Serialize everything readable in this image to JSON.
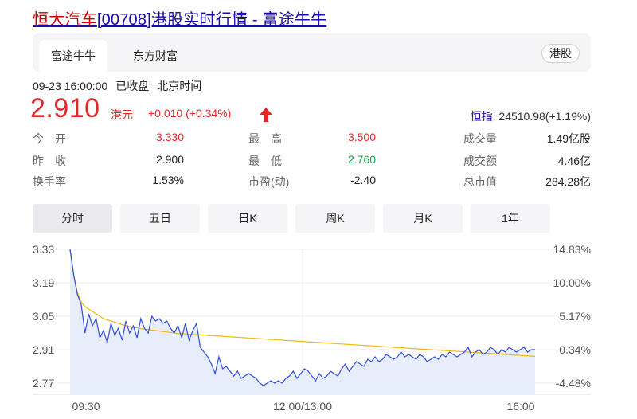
{
  "title": {
    "brand": "恒大汽车",
    "rest": "[00708]港股实时行情 - 富途牛牛"
  },
  "tabs": [
    {
      "label": "富途牛牛",
      "active": true
    },
    {
      "label": "东方财富",
      "active": false
    }
  ],
  "market_pill": "港股",
  "status": {
    "datetime": "09-23 16:00:00",
    "state": "已收盘",
    "timezone": "北京时间"
  },
  "quote": {
    "price": "2.910",
    "currency": "港元",
    "change": "+0.010 (+0.34%)",
    "direction": "up"
  },
  "index": {
    "label": "恒指",
    "value": ": 24510.98(+1.19%)"
  },
  "stats": [
    [
      {
        "label": "今　开",
        "value": "3.330",
        "color": "red"
      },
      {
        "label": "最　高",
        "value": "3.500",
        "color": "red"
      },
      {
        "label": "成交量",
        "value": "1.49亿股",
        "color": "normal"
      }
    ],
    [
      {
        "label": "昨　收",
        "value": "2.900",
        "color": "normal"
      },
      {
        "label": "最　低",
        "value": "2.760",
        "color": "green"
      },
      {
        "label": "成交额",
        "value": "4.46亿",
        "color": "normal"
      }
    ],
    [
      {
        "label": "换手率",
        "value": "1.53%",
        "color": "normal"
      },
      {
        "label": "市盈(动)",
        "value": "-2.40",
        "color": "normal"
      },
      {
        "label": "总市值",
        "value": "284.28亿",
        "color": "normal"
      }
    ]
  ],
  "periods": [
    {
      "label": "分时",
      "active": true
    },
    {
      "label": "五日",
      "active": false
    },
    {
      "label": "日K",
      "active": false
    },
    {
      "label": "周K",
      "active": false
    },
    {
      "label": "月K",
      "active": false
    },
    {
      "label": "1年",
      "active": false
    }
  ],
  "colors": {
    "up": "#e0282a",
    "down": "#1aa350",
    "price_line": "#2f4fd9",
    "avg_line": "#f0b90b",
    "area_fill": "#e8edfb"
  },
  "chart_data": {
    "type": "line",
    "x_ticks": [
      "09:30",
      "12:00/13:00",
      "16:00"
    ],
    "y_ticks_left": [
      "3.33",
      "3.19",
      "3.05",
      "2.91",
      "2.77"
    ],
    "y_ticks_right": [
      "14.83%",
      "10.00%",
      "5.17%",
      "0.34%",
      "-4.48%"
    ],
    "ylim": [
      2.77,
      3.33
    ],
    "series": [
      {
        "role": "price",
        "values": [
          3.33,
          3.22,
          3.14,
          3.1,
          2.98,
          3.06,
          3.01,
          3.04,
          2.96,
          2.99,
          2.94,
          3.02,
          2.97,
          3.0,
          2.95,
          3.03,
          2.98,
          3.01,
          2.96,
          3.04,
          3.0,
          2.98,
          3.05,
          3.03,
          3.04,
          3.02,
          3.03,
          3.0,
          2.98,
          3.01,
          2.96,
          3.02,
          2.95,
          2.99,
          3.02,
          2.92,
          2.9,
          2.88,
          2.85,
          2.81,
          2.88,
          2.83,
          2.84,
          2.82,
          2.8,
          2.82,
          2.79,
          2.8,
          2.81,
          2.8,
          2.79,
          2.77,
          2.76,
          2.77,
          2.78,
          2.77,
          2.78,
          2.77,
          2.79,
          2.8,
          2.82,
          2.79,
          2.81,
          2.83,
          2.82,
          2.8,
          2.78,
          2.81,
          2.79,
          2.8,
          2.82,
          2.81,
          2.8,
          2.83,
          2.85,
          2.82,
          2.84,
          2.86,
          2.85,
          2.84,
          2.87,
          2.86,
          2.88,
          2.86,
          2.87,
          2.89,
          2.88,
          2.87,
          2.88,
          2.9,
          2.88,
          2.89,
          2.88,
          2.87,
          2.89,
          2.88,
          2.86,
          2.87,
          2.88,
          2.87,
          2.89,
          2.88,
          2.9,
          2.89,
          2.88,
          2.89,
          2.9,
          2.92,
          2.88,
          2.9,
          2.91,
          2.89,
          2.9,
          2.92,
          2.91,
          2.89,
          2.91,
          2.9,
          2.92,
          2.91,
          2.9,
          2.91,
          2.92,
          2.9,
          2.91,
          2.91
        ]
      },
      {
        "role": "average",
        "values": [
          3.33,
          3.22,
          3.15,
          3.11,
          3.09,
          3.08,
          3.07,
          3.06,
          3.05,
          3.04,
          3.035,
          3.03,
          3.025,
          3.02,
          3.015,
          3.01,
          3.007,
          3.004,
          3.001,
          2.998,
          2.996,
          2.994,
          2.992,
          2.99,
          2.988,
          2.986,
          2.984,
          2.982,
          2.98,
          2.978,
          2.977,
          2.976,
          2.975,
          2.974,
          2.973,
          2.972,
          2.971,
          2.97,
          2.969,
          2.968,
          2.967,
          2.966,
          2.965,
          2.964,
          2.963,
          2.962,
          2.961,
          2.96,
          2.959,
          2.958,
          2.957,
          2.956,
          2.955,
          2.954,
          2.953,
          2.952,
          2.951,
          2.95,
          2.949,
          2.948,
          2.947,
          2.946,
          2.945,
          2.944,
          2.943,
          2.942,
          2.941,
          2.94,
          2.939,
          2.938,
          2.937,
          2.936,
          2.935,
          2.934,
          2.933,
          2.932,
          2.931,
          2.93,
          2.929,
          2.928,
          2.927,
          2.926,
          2.925,
          2.924,
          2.923,
          2.922,
          2.921,
          2.92,
          2.919,
          2.918,
          2.917,
          2.916,
          2.915,
          2.914,
          2.913,
          2.912,
          2.911,
          2.91,
          2.909,
          2.908,
          2.907,
          2.906,
          2.905,
          2.904,
          2.903,
          2.902,
          2.901,
          2.9,
          2.899,
          2.898,
          2.897,
          2.896,
          2.895,
          2.894,
          2.893,
          2.892,
          2.891,
          2.89,
          2.889,
          2.888,
          2.887,
          2.886,
          2.885,
          2.884,
          2.883,
          2.882
        ]
      }
    ]
  }
}
